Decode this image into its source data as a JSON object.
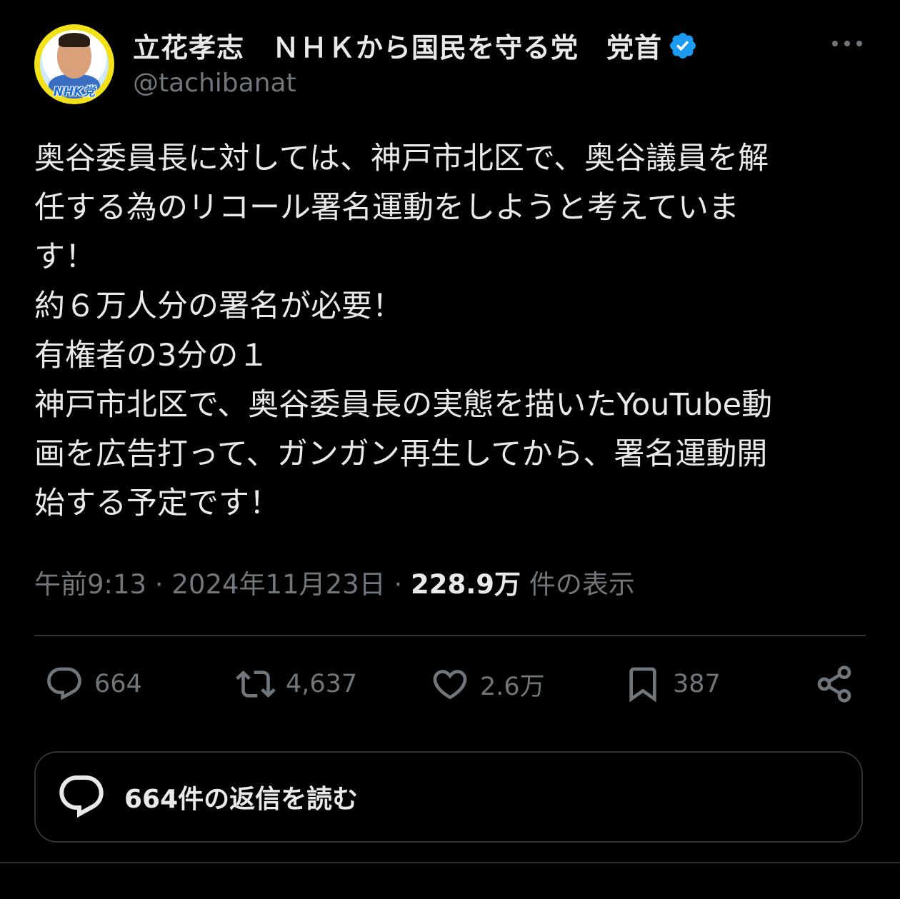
{
  "author": {
    "display_name": "立花孝志　ＮＨＫから国民を守る党　党首",
    "handle": "@tachibanat",
    "avatar_badge_text": "NHK党"
  },
  "tweet": {
    "text": "奥谷委員長に対しては、神戸市北区で、奥谷議員を解\n任する為のリコール署名運動をしようと考えていま\nす！\n約６万人分の署名が必要！\n有権者の3分の１\n神戸市北区で、奥谷委員長の実態を描いたYouTube動\n画を広告打って、ガンガン再生してから、署名運動開\n始する予定です！",
    "time": "午前9:13",
    "separator": "·",
    "date": "2024年11月23日",
    "views_count": "228.9万",
    "views_label": "件の表示"
  },
  "actions": {
    "replies": "664",
    "retweets": "4,637",
    "likes": "2.6万",
    "bookmarks": "387"
  },
  "read_replies_label": "664件の返信を読む",
  "colors": {
    "background": "#000000",
    "text": "#e7e9ea",
    "muted": "#71767b",
    "verified": "#1d9bf0",
    "border": "#2f3336"
  }
}
